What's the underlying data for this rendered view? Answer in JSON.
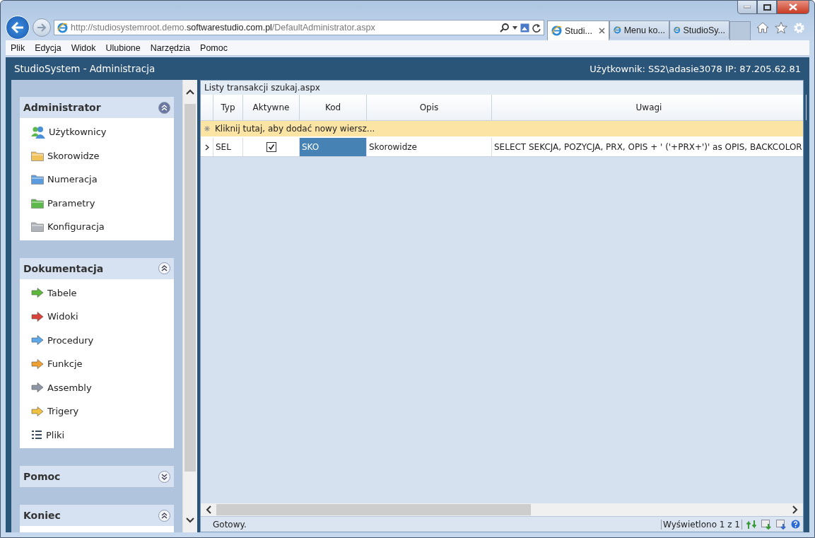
{
  "browser": {
    "url": {
      "prefix": "http://studiosystemroot.demo.",
      "domain": "softwarestudio.com.pl",
      "path": "/DefaultAdministrator.aspx"
    },
    "tabs": [
      {
        "label": "Studi...",
        "selected": true
      },
      {
        "label": "Menu ko...",
        "selected": false
      },
      {
        "label": "StudioSy...",
        "selected": false
      }
    ],
    "menu": [
      "Plik",
      "Edycja",
      "Widok",
      "Ulubione",
      "Narzędzia",
      "Pomoc"
    ]
  },
  "app": {
    "title": "StudioSystem - Administracja",
    "user_info": "Użytkownik: SS2\\adasie3078 IP: 87.205.62.81"
  },
  "sidebar": {
    "sections": [
      {
        "title": "Administrator",
        "expanded": true,
        "items": [
          {
            "label": "Użytkownicy",
            "kind": "users",
            "color": "#4a8fd8"
          },
          {
            "label": "Skorowidze",
            "kind": "folder",
            "color": "#f2c25a"
          },
          {
            "label": "Numeracja",
            "kind": "folder",
            "color": "#5b9be0"
          },
          {
            "label": "Parametry",
            "kind": "folder",
            "color": "#5cb84a"
          },
          {
            "label": "Konfiguracja",
            "kind": "folder",
            "color": "#b0b4ba"
          }
        ]
      },
      {
        "title": "Dokumentacja",
        "expanded": true,
        "items": [
          {
            "label": "Tabele",
            "kind": "arrow",
            "color": "#5cb83a"
          },
          {
            "label": "Widoki",
            "kind": "arrow",
            "color": "#d9433a"
          },
          {
            "label": "Procedury",
            "kind": "arrow",
            "color": "#5ca8e8"
          },
          {
            "label": "Funkcje",
            "kind": "arrow",
            "color": "#f0a030"
          },
          {
            "label": "Assembly",
            "kind": "arrow",
            "color": "#8c96a4"
          },
          {
            "label": "Trigery",
            "kind": "arrow",
            "color": "#f0c040"
          },
          {
            "label": "Pliki",
            "kind": "list",
            "color": "#3a4a60"
          }
        ]
      },
      {
        "title": "Pomoc",
        "expanded": false
      },
      {
        "title": "Koniec",
        "expanded": true
      }
    ]
  },
  "grid": {
    "caption": "Listy transakcji szukaj.aspx",
    "columns": [
      "Typ",
      "Aktywne",
      "Kod",
      "Opis",
      "Uwagi"
    ],
    "new_row": "Kliknij tutaj, aby dodać nowy wiersz...",
    "rows": [
      {
        "selected": true,
        "typ": "SEL",
        "aktywne": true,
        "kod": "SKO",
        "opis": "Skorowidze",
        "uwagi": "SELECT SEKCJA, POZYCJA, PRX, OPIS + ' ('+PRX+')' as OPIS, BACKCOLOR"
      }
    ],
    "status": "Gotowy.",
    "paging": "Wyświetlono 1 z 1"
  }
}
